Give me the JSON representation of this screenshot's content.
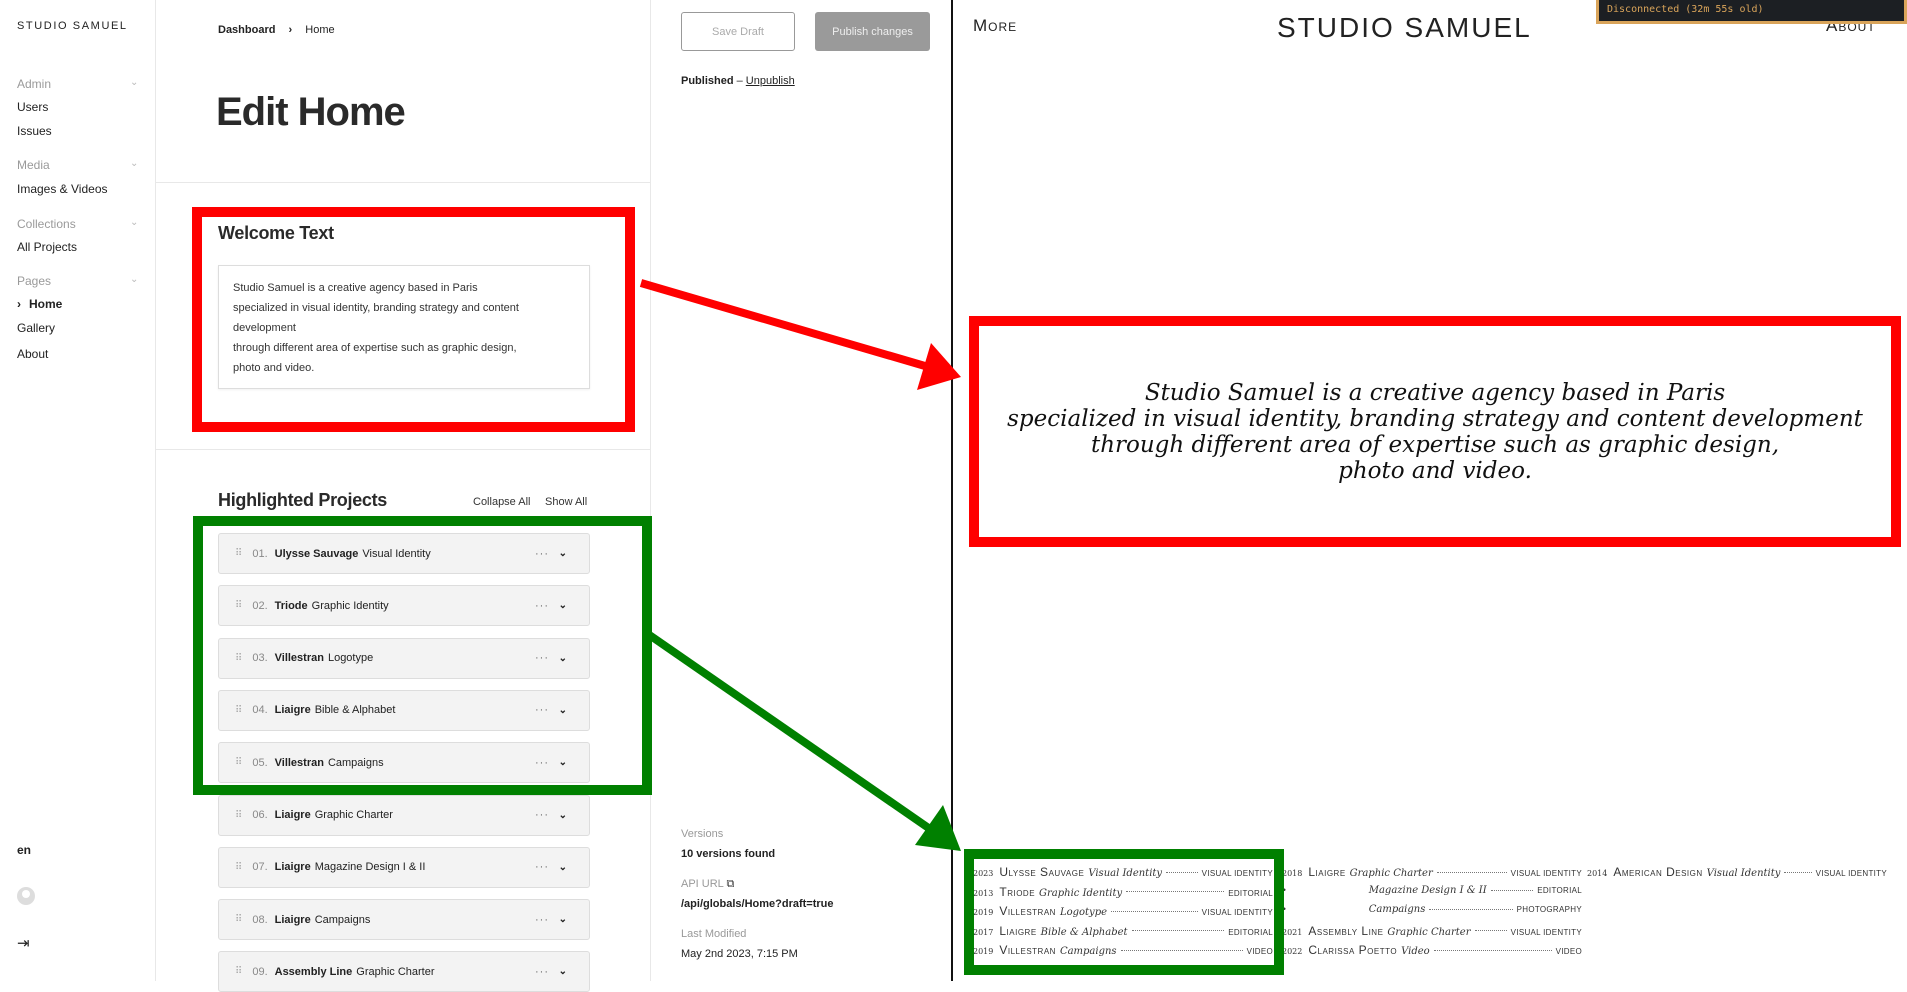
{
  "sidebar": {
    "logo": "STUDIO SAMUEL",
    "groups": [
      {
        "label": "Admin",
        "items": [
          "Users",
          "Issues"
        ]
      },
      {
        "label": "Media",
        "items": [
          "Images & Videos"
        ]
      },
      {
        "label": "Collections",
        "items": [
          "All Projects"
        ]
      },
      {
        "label": "Pages",
        "items": [
          "Home",
          "Gallery",
          "About"
        ]
      }
    ],
    "active": "Home",
    "locale": "en"
  },
  "breadcrumb": {
    "parent": "Dashboard",
    "current": "Home"
  },
  "page_title": "Edit Home",
  "welcome": {
    "heading": "Welcome Text",
    "lines": [
      "Studio Samuel is a creative agency based in Paris",
      "specialized in visual identity, branding strategy and content",
      "development",
      "through different area of expertise such as graphic design,",
      "photo and video."
    ]
  },
  "projects": {
    "heading": "Highlighted Projects",
    "collapse_all": "Collapse All",
    "show_all": "Show All",
    "rows": [
      {
        "num": "01.",
        "client": "Ulysse Sauvage",
        "title": "Visual Identity"
      },
      {
        "num": "02.",
        "client": "Triode",
        "title": "Graphic Identity"
      },
      {
        "num": "03.",
        "client": "Villestran",
        "title": "Logotype"
      },
      {
        "num": "04.",
        "client": "Liaigre",
        "title": "Bible & Alphabet"
      },
      {
        "num": "05.",
        "client": "Villestran",
        "title": "Campaigns"
      },
      {
        "num": "06.",
        "client": "Liaigre",
        "title": "Graphic Charter"
      },
      {
        "num": "07.",
        "client": "Liaigre",
        "title": "Magazine Design I & II"
      },
      {
        "num": "08.",
        "client": "Liaigre",
        "title": "Campaigns"
      },
      {
        "num": "09.",
        "client": "Assembly Line",
        "title": "Graphic Charter"
      }
    ]
  },
  "actions": {
    "save_draft": "Save Draft",
    "publish": "Publish changes",
    "status": "Published",
    "unpublish": "Unpublish"
  },
  "meta": {
    "versions_label": "Versions",
    "versions_value": "10 versions found",
    "api_label": "API URL",
    "api_value": "/api/globals/Home?draft=true",
    "modified_label": "Last Modified",
    "modified_value": "May 2nd 2023, 7:15 PM"
  },
  "preview": {
    "more": "More",
    "logo": "STUDIO SAMUEL",
    "about": "About",
    "status": "Disconnected (32m 55s old)",
    "welcome_lines": [
      "Studio Samuel is a creative agency based in Paris",
      "specialized in visual identity, branding strategy and content development",
      "through different area of expertise such as graphic design,",
      "photo and video."
    ],
    "columns": [
      [
        {
          "year": "2023",
          "client": "Ulysse Sauvage",
          "title": "Visual Identity",
          "cat": "Visual Identity"
        },
        {
          "year": "2013",
          "client": "Triode",
          "title": "Graphic Identity",
          "cat": "Editorial"
        },
        {
          "year": "2019",
          "client": "Villestran",
          "title": "Logotype",
          "cat": "Visual Identity"
        },
        {
          "year": "2017",
          "client": "Liaigre",
          "title": "Bible & Alphabet",
          "cat": "Editorial"
        },
        {
          "year": "2019",
          "client": "Villestran",
          "title": "Campaigns",
          "cat": "Video"
        }
      ],
      [
        {
          "year": "2018",
          "client": "Liaigre",
          "title": "Graphic Charter",
          "cat": "Visual Identity"
        },
        {
          "year": "•",
          "client": "",
          "title": "Magazine Design I & II",
          "cat": "Editorial"
        },
        {
          "year": "•",
          "client": "",
          "title": "Campaigns",
          "cat": "Photography"
        },
        {
          "year": "2021",
          "client": "Assembly Line",
          "title": "Graphic Charter",
          "cat": "Visual Identity"
        },
        {
          "year": "2022",
          "client": "Clarissa Poetto",
          "title": "Video",
          "cat": "Video"
        }
      ],
      [
        {
          "year": "2014",
          "client": "American Design",
          "title": "Visual Identity",
          "cat": "Visual Identity"
        }
      ]
    ]
  },
  "annotation_colors": {
    "red": "#ff0000",
    "green": "#008000"
  }
}
